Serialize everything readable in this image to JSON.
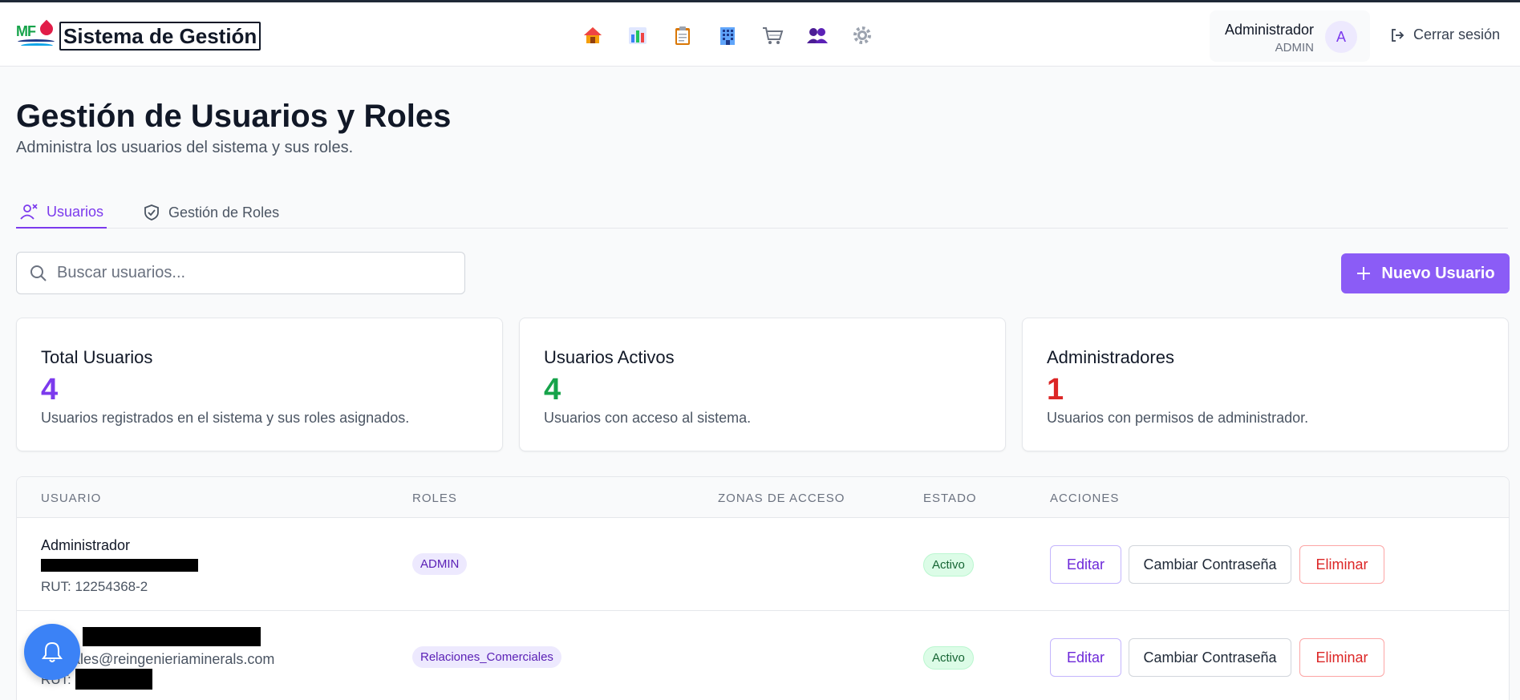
{
  "header": {
    "brand_title": "Sistema de Gestión",
    "logo_text": "MF",
    "nav_icons": [
      "home-icon",
      "chart-icon",
      "clipboard-icon",
      "building-icon",
      "cart-icon",
      "users-icon",
      "gear-icon"
    ],
    "user_name": "Administrador",
    "user_role": "ADMIN",
    "avatar_initial": "A",
    "logout_label": "Cerrar sesión"
  },
  "page": {
    "title": "Gestión de Usuarios y Roles",
    "subtitle": "Administra los usuarios del sistema y sus roles."
  },
  "tabs": [
    {
      "label": "Usuarios",
      "active": true
    },
    {
      "label": "Gestión de Roles",
      "active": false
    }
  ],
  "search": {
    "placeholder": "Buscar usuarios...",
    "value": ""
  },
  "new_user_label": "Nuevo Usuario",
  "stats": [
    {
      "title": "Total Usuarios",
      "value": "4",
      "desc": "Usuarios registrados en el sistema y sus roles asignados.",
      "color": "#7c3aed"
    },
    {
      "title": "Usuarios Activos",
      "value": "4",
      "desc": "Usuarios con acceso al sistema.",
      "color": "#16a34a"
    },
    {
      "title": "Administradores",
      "value": "1",
      "desc": "Usuarios con permisos de administrador.",
      "color": "#dc2626"
    }
  ],
  "table": {
    "headers": [
      "USUARIO",
      "ROLES",
      "ZONAS DE ACCESO",
      "ESTADO",
      "ACCIONES"
    ],
    "rows": [
      {
        "name": "Administrador",
        "email": "",
        "rut": "RUT: 12254368-2",
        "role": "ADMIN",
        "zones": "",
        "status": "Activo"
      },
      {
        "name": "",
        "email": "rciales@reingenieriaminerals.com",
        "rut": "RUT:",
        "role": "Relaciones_Comerciales",
        "zones": "",
        "status": "Activo"
      }
    ],
    "actions": {
      "edit": "Editar",
      "password": "Cambiar Contraseña",
      "delete": "Eliminar"
    }
  },
  "colors": {
    "accent": "#8b5cf6",
    "notification": "#3b82f6"
  }
}
